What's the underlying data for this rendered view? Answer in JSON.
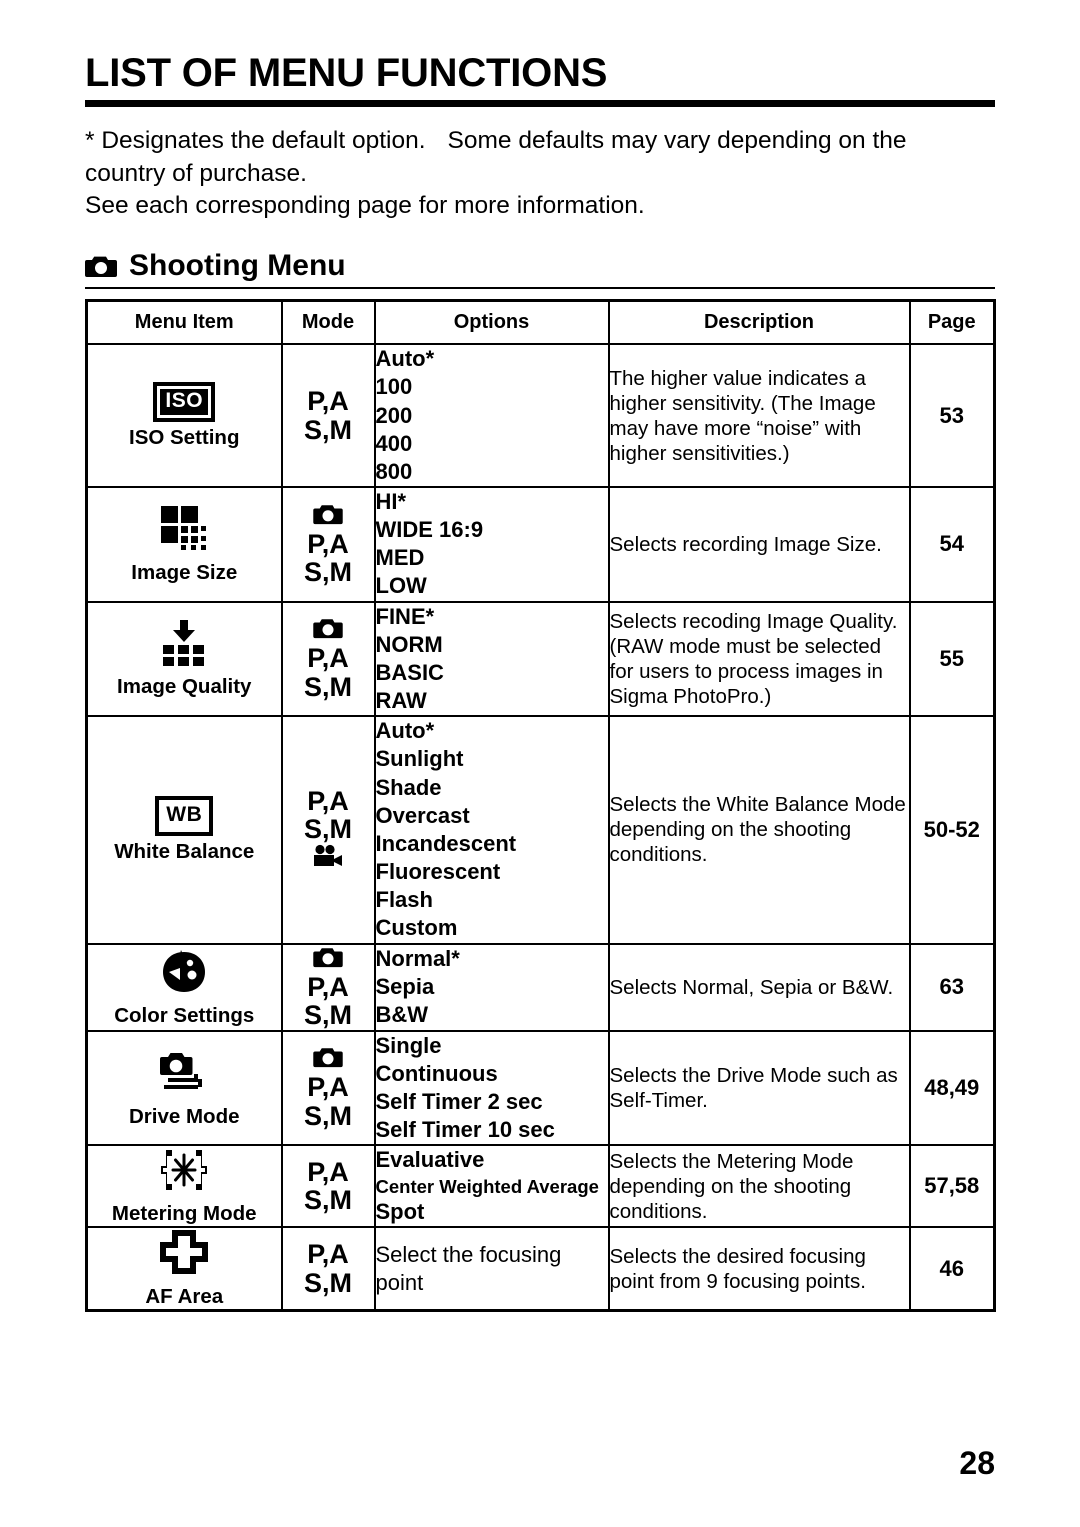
{
  "document": {
    "title": "LIST OF MENU FUNCTIONS",
    "intro_line1_a": "* Designates the default option.",
    "intro_line1_b": "Some defaults may vary depending on the",
    "intro_line2": "country of purchase.",
    "intro_line3": "See each corresponding page for more information.",
    "page_number": "28"
  },
  "section": {
    "icon": "camera-icon",
    "label": "Shooting Menu"
  },
  "table": {
    "headers": {
      "menu_item": "Menu Item",
      "mode": "Mode",
      "options": "Options",
      "description": "Description",
      "page": "Page"
    },
    "rows": [
      {
        "icon": "iso-icon",
        "icon_text": "ISO",
        "label": "ISO Setting",
        "mode_camera": false,
        "mode_video": false,
        "mode_line1": "P",
        "mode_sep1": ",",
        "mode_line1b": "A",
        "mode_line2": "S",
        "mode_sep2": ",",
        "mode_line2b": "M",
        "options": [
          "Auto*",
          "100",
          "200",
          "400",
          "800"
        ],
        "description": "The higher value indicates a higher sensitivity. (The Image may have more “noise” with higher sensitivities.)",
        "page": "53"
      },
      {
        "icon": "image-size-icon",
        "icon_text": "",
        "label": "Image Size",
        "mode_camera": true,
        "mode_video": false,
        "mode_line1": "P",
        "mode_sep1": ",",
        "mode_line1b": "A",
        "mode_line2": "S",
        "mode_sep2": ",",
        "mode_line2b": "M",
        "options": [
          "HI*",
          "WIDE 16:9",
          "MED",
          "LOW"
        ],
        "description": "Selects recording Image Size.",
        "page": "54"
      },
      {
        "icon": "image-quality-icon",
        "icon_text": "",
        "label": "Image Quality",
        "mode_camera": true,
        "mode_video": false,
        "mode_line1": "P",
        "mode_sep1": ",",
        "mode_line1b": "A",
        "mode_line2": "S",
        "mode_sep2": ",",
        "mode_line2b": "M",
        "options": [
          "FINE*",
          "NORM",
          "BASIC",
          "RAW"
        ],
        "description": "Selects recoding Image Quality. (RAW mode must be selected for users to process images in Sigma PhotoPro.)",
        "page": "55"
      },
      {
        "icon": "white-balance-icon",
        "icon_text": "WB",
        "label": "White Balance",
        "mode_camera": false,
        "mode_video": true,
        "mode_line1": "P",
        "mode_sep1": ",",
        "mode_line1b": "A",
        "mode_line2": "S",
        "mode_sep2": ",",
        "mode_line2b": "M",
        "options": [
          "Auto*",
          "Sunlight",
          "Shade",
          "Overcast",
          "Incandescent",
          "Fluorescent",
          "Flash",
          "Custom"
        ],
        "description": "Selects the White Balance Mode depending on the shooting conditions.",
        "page": "50-52"
      },
      {
        "icon": "color-settings-icon",
        "icon_text": "",
        "label": "Color Settings",
        "mode_camera": true,
        "mode_video": false,
        "mode_line1": "P",
        "mode_sep1": ",",
        "mode_line1b": "A",
        "mode_line2": "S",
        "mode_sep2": ",",
        "mode_line2b": "M",
        "options": [
          "Normal*",
          "Sepia",
          "B&W"
        ],
        "description": "Selects Normal, Sepia or B&W.",
        "page": "63"
      },
      {
        "icon": "drive-mode-icon",
        "icon_text": "",
        "label": "Drive Mode",
        "mode_camera": true,
        "mode_video": false,
        "mode_line1": "P",
        "mode_sep1": ",",
        "mode_line1b": "A",
        "mode_line2": "S",
        "mode_sep2": ",",
        "mode_line2b": "M",
        "options": [
          "Single",
          "Continuous",
          "Self Timer 2 sec",
          "Self Timer 10 sec"
        ],
        "description": "Selects the Drive Mode such as Self-Timer.",
        "page": "48,49"
      },
      {
        "icon": "metering-mode-icon",
        "icon_text": "",
        "label": "Metering Mode",
        "mode_camera": false,
        "mode_video": false,
        "mode_line1": "P",
        "mode_sep1": ",",
        "mode_line1b": "A",
        "mode_line2": "S",
        "mode_sep2": ",",
        "mode_line2b": "M",
        "options": [
          "Evaluative",
          "Center Weighted Average",
          "Spot"
        ],
        "description": "Selects the Metering Mode depending on the shooting conditions.",
        "page": "57,58"
      },
      {
        "icon": "af-area-icon",
        "icon_text": "",
        "label": "AF Area",
        "mode_camera": false,
        "mode_video": false,
        "mode_line1": "P",
        "mode_sep1": ",",
        "mode_line1b": "A",
        "mode_line2": "S",
        "mode_sep2": ",",
        "mode_line2b": "M",
        "options": [
          "Select the focusing",
          "point"
        ],
        "description": "Selects the desired focusing point from 9 focusing points.",
        "page": "46"
      }
    ]
  }
}
